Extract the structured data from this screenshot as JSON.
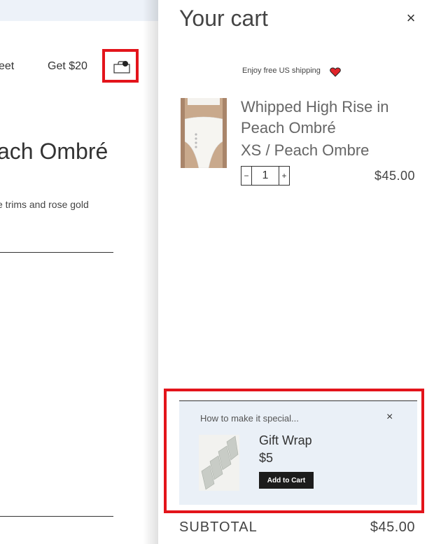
{
  "background": {
    "nav_links": [
      "eet",
      "Get $20"
    ],
    "product_title": "ach Ombré",
    "product_description": "e trims and rose gold",
    "cart_icon": "shopping-bag-icon"
  },
  "cart": {
    "title": "Your cart",
    "close_icon": "close-icon",
    "shipping_note": "Enjoy free US shipping",
    "shipping_icon": "heart-icon",
    "item": {
      "name": "Whipped High Rise in Peach Ombré",
      "variant": "XS / Peach Ombre",
      "quantity": "1",
      "decrement_label": "−",
      "increment_label": "+",
      "price": "$45.00"
    },
    "upsell": {
      "heading": "How to make it special...",
      "close_label": "×",
      "product_name": "Gift Wrap",
      "product_price": "$5",
      "button_label": "Add to Cart"
    },
    "subtotal_label": "SUBTOTAL",
    "subtotal_value": "$45.00"
  },
  "colors": {
    "highlight": "#e3141b",
    "upsell_bg": "#eaf0f7",
    "button_bg": "#1c1c1c",
    "top_bar": "#edf2f9"
  }
}
